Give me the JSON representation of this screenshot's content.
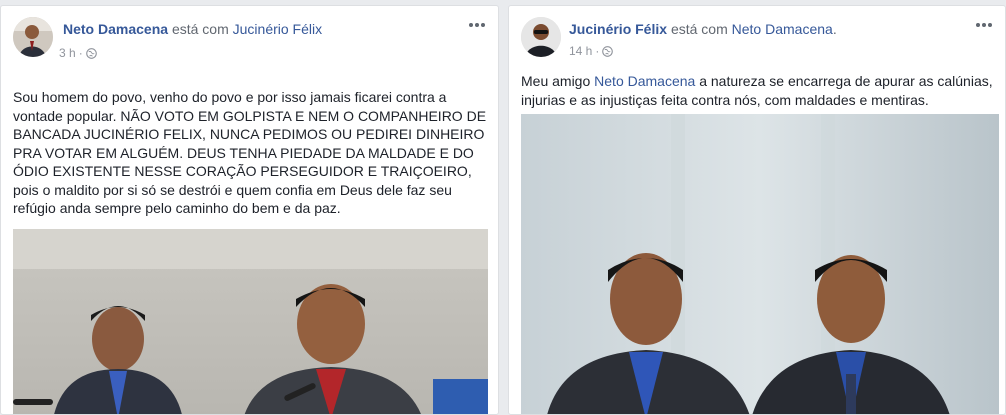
{
  "posts": [
    {
      "author": "Neto Damacena",
      "with_text": "está com",
      "tagged": "Jucinério Félix",
      "tagged_suffix": "",
      "time": "3 h",
      "text_lines": [
        "Sou homem do povo, venho do povo e por isso jamais ficarei contra a",
        "vontade popular. NÃO VOTO EM GOLPISTA E NEM O COMPANHEIRO DE",
        "BANCADA JUCINÉRIO FELIX, NUNCA PEDIMOS OU PEDIREI DINHEIRO",
        "PRA VOTAR EM ALGUÉM. DEUS TENHA PIEDADE DA MALDADE E DO",
        "ÓDIO EXISTENTE NESSE CORAÇÃO PERSEGUIDOR E TRAIÇOEIRO,",
        "pois o maldito por si só se destrói e quem confia em Deus dele faz seu",
        "refúgio anda sempre pelo caminho do bem e da paz."
      ],
      "icons": {
        "avatar": "profile-photo",
        "privacy": "globe-icon",
        "more": "more-options-icon"
      }
    },
    {
      "author": "Jucinério Félix",
      "with_text": "está com",
      "tagged": "Neto Damacena",
      "tagged_suffix": ".",
      "time": "14 h",
      "text_prefix": "Meu amigo ",
      "mention": "Neto Damacena",
      "text_rest": " a natureza se encarrega de apurar as calúnias,",
      "text_line2": "injurias e as injustiças feita contra nós, com maldades e mentiras.",
      "icons": {
        "avatar": "profile-photo",
        "privacy": "globe-icon",
        "more": "more-options-icon"
      }
    }
  ],
  "colors": {
    "page_bg": "#e9ebee",
    "link": "#365899",
    "text": "#1d2129",
    "meta": "#90949c"
  }
}
